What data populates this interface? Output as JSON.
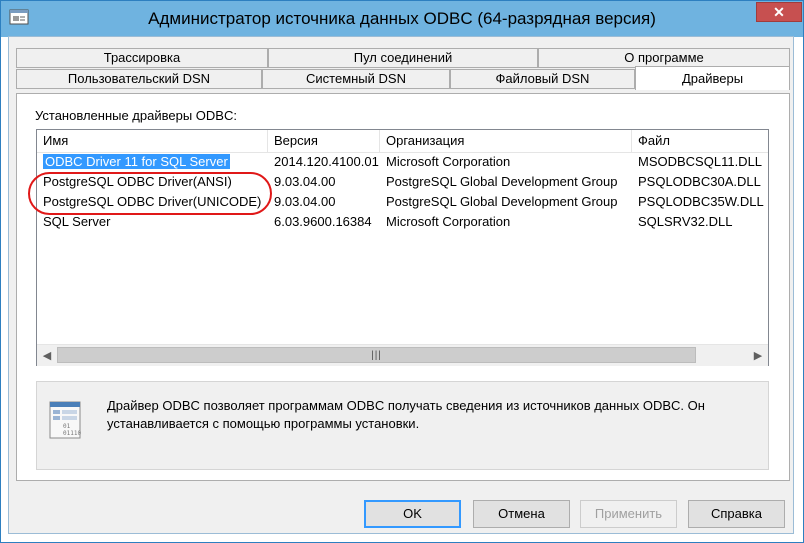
{
  "window": {
    "title": "Администратор источника данных ODBC (64-разрядная версия)"
  },
  "tabs_row1": [
    "Трассировка",
    "Пул соединений",
    "О программе"
  ],
  "tabs_row2": [
    "Пользовательский DSN",
    "Системный DSN",
    "Файловый DSN",
    "Драйверы"
  ],
  "active_tab": "Драйверы",
  "drivers_label": "Установленные драйверы ODBC:",
  "columns": [
    "Имя",
    "Версия",
    "Организация",
    "Файл"
  ],
  "rows": [
    [
      "ODBC Driver 11 for SQL Server",
      "2014.120.4100.01",
      "Microsoft Corporation",
      "MSODBCSQL11.DLL"
    ],
    [
      "PostgreSQL ODBC Driver(ANSI)",
      "9.03.04.00",
      "PostgreSQL Global Development Group",
      "PSQLODBC30A.DLL"
    ],
    [
      "PostgreSQL ODBC Driver(UNICODE)",
      "9.03.04.00",
      "PostgreSQL Global Development Group",
      "PSQLODBC35W.DLL"
    ],
    [
      "SQL Server",
      "6.03.9600.16384",
      "Microsoft Corporation",
      "SQLSRV32.DLL"
    ]
  ],
  "info_text": "Драйвер ODBC позволяет программам ODBC получать сведения из источников данных ODBC.  Он устанавливается с помощью программы установки.",
  "buttons": {
    "ok": "OK",
    "cancel": "Отмена",
    "apply": "Применить",
    "help": "Справка"
  },
  "icons": {
    "app": "odbc-app-icon",
    "info": "document-binary-icon"
  },
  "colors": {
    "titlebar": "#6fb3e0",
    "selection": "#3399ff",
    "annotation": "#e01818",
    "close": "#c75050"
  }
}
